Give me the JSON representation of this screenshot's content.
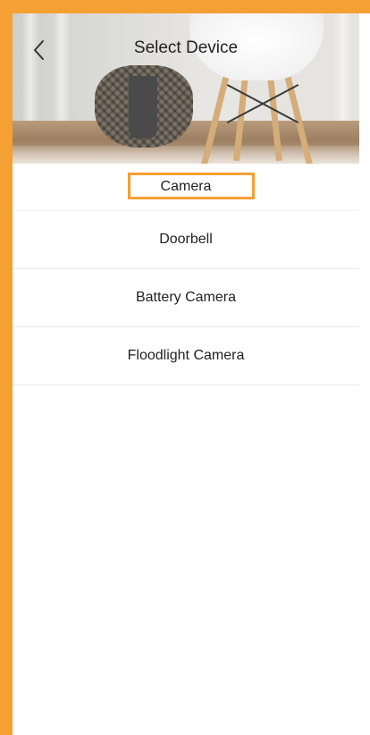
{
  "header": {
    "title": "Select Device",
    "back_icon": "chevron-left-icon"
  },
  "devices": [
    {
      "label": "Camera",
      "highlighted": true
    },
    {
      "label": "Doorbell",
      "highlighted": false
    },
    {
      "label": "Battery Camera",
      "highlighted": false
    },
    {
      "label": "Floodlight Camera",
      "highlighted": false
    }
  ],
  "colors": {
    "annotation": "#f5a033",
    "text": "#222222",
    "divider": "#e9e9e9"
  }
}
